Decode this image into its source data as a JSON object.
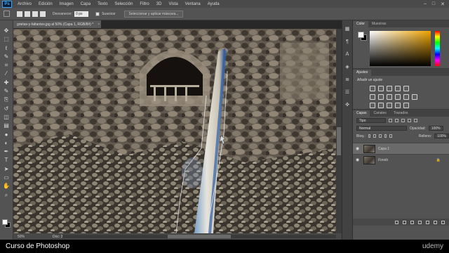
{
  "menubar": {
    "logo": "Ps",
    "items": [
      "Archivo",
      "Edición",
      "Imagen",
      "Capa",
      "Texto",
      "Selección",
      "Filtro",
      "3D",
      "Vista",
      "Ventana",
      "Ayuda"
    ],
    "window_controls": [
      "–",
      "□",
      "✕"
    ]
  },
  "options_bar": {
    "feather_label": "Desvanecer:",
    "feather_value": "0 px",
    "smooth_label": "Suavizar",
    "select_mask_button": "Seleccionar y aplicar máscara..."
  },
  "tools": [
    "move-icon",
    "marquee-icon",
    "lasso-icon",
    "quick-select-icon",
    "crop-icon",
    "eyedropper-icon",
    "healing-icon",
    "brush-icon",
    "stamp-icon",
    "history-brush-icon",
    "eraser-icon",
    "gradient-icon",
    "blur-icon",
    "dodge-icon",
    "pen-icon",
    "type-icon",
    "path-select-icon",
    "shape-icon",
    "hand-icon",
    "zoom-icon"
  ],
  "tool_glyphs": [
    "✥",
    "⬚",
    "ℓ",
    "✎",
    "⌗",
    "⁄",
    "✚",
    "✎",
    "⎘",
    "↺",
    "◫",
    "▤",
    "●",
    "◐",
    "✒",
    "T",
    "➤",
    "▭",
    "✋",
    "⌕"
  ],
  "document": {
    "tab_title": "grietas-y-faltantes.jpg al 50% (Capa 1, RGB/8#) *",
    "close": "×",
    "zoom": "50%",
    "doc_info": "Doc: 36,7 MB/103,4 MB"
  },
  "dock_glyphs": [
    "▦",
    "¶",
    "Ａ",
    "◈",
    "≣",
    "☰",
    "✜"
  ],
  "color_panel": {
    "tabs": [
      "Color",
      "Muestras"
    ],
    "accent": "#f0a400"
  },
  "adjustments_panel": {
    "tab": "Ajustes",
    "subtitle": "Añadir un ajuste",
    "icon_count": 18
  },
  "layers_panel": {
    "tabs": [
      "Capas",
      "Canales",
      "Trazados"
    ],
    "kind_filter": "Tipo",
    "blend_mode": "Normal",
    "opacity_label": "Opacidad:",
    "opacity_value": "100%",
    "lock_label": "Bloq.:",
    "fill_label": "Relleno:",
    "fill_value": "100%",
    "layers": [
      {
        "name": "Capa 1",
        "selected": true,
        "locked": false
      },
      {
        "name": "Fondo",
        "selected": false,
        "locked": true
      }
    ]
  },
  "caption": {
    "course_title": "Curso de Photoshop",
    "brand": "udemy"
  }
}
